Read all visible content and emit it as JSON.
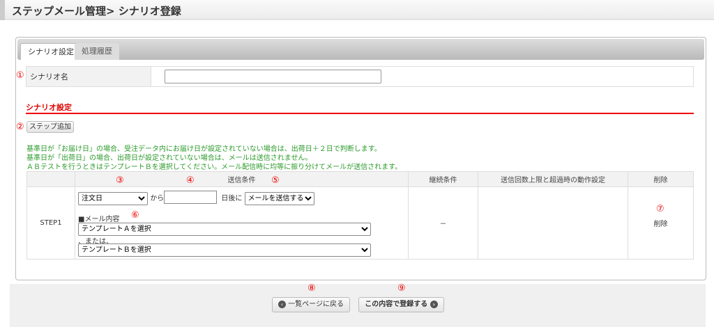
{
  "header": {
    "title": "ステップメール管理> シナリオ登録"
  },
  "tabs": [
    {
      "label": "シナリオ設定"
    },
    {
      "label": "処理履歴"
    }
  ],
  "markers": [
    "①",
    "②",
    "③",
    "④",
    "⑤",
    "⑥",
    "⑦",
    "⑧",
    "⑨"
  ],
  "scenario_name": {
    "label": "シナリオ名",
    "value": ""
  },
  "section": {
    "title": "シナリオ設定",
    "add_step_label": "ステップ追加"
  },
  "notes": [
    "基準日が「お届け日」の場合、受注データ内にお届け日が設定されていない場合は、出荷日＋２日で判断します。",
    "基準日が「出荷日」の場合、出荷日が設定されていない場合は、メールは送信されません。",
    "ＡＢテストを行うときはテンプレートＢを選択してください。メール配信時に均等に振り分けてメールが送信されます。"
  ],
  "table": {
    "headers": [
      "",
      "送信条件",
      "継続条件",
      "送信回数上限と超過時の動作設定",
      "削除"
    ],
    "rows": [
      {
        "step": "STEP1",
        "base_date": "注文日",
        "from_label": "から",
        "days": "",
        "days_after_label": "日後に",
        "action": "メールを送信する",
        "mail_content_label": "■メール内容",
        "template_a": "テンプレートＡを選択",
        "or_label": "、または、",
        "template_b": "テンプレートＢを選択",
        "continue": "－",
        "limit": "",
        "delete_label": "削除"
      }
    ]
  },
  "footer": {
    "back_label": "一覧ページに戻る",
    "submit_label": "この内容で登録する"
  }
}
